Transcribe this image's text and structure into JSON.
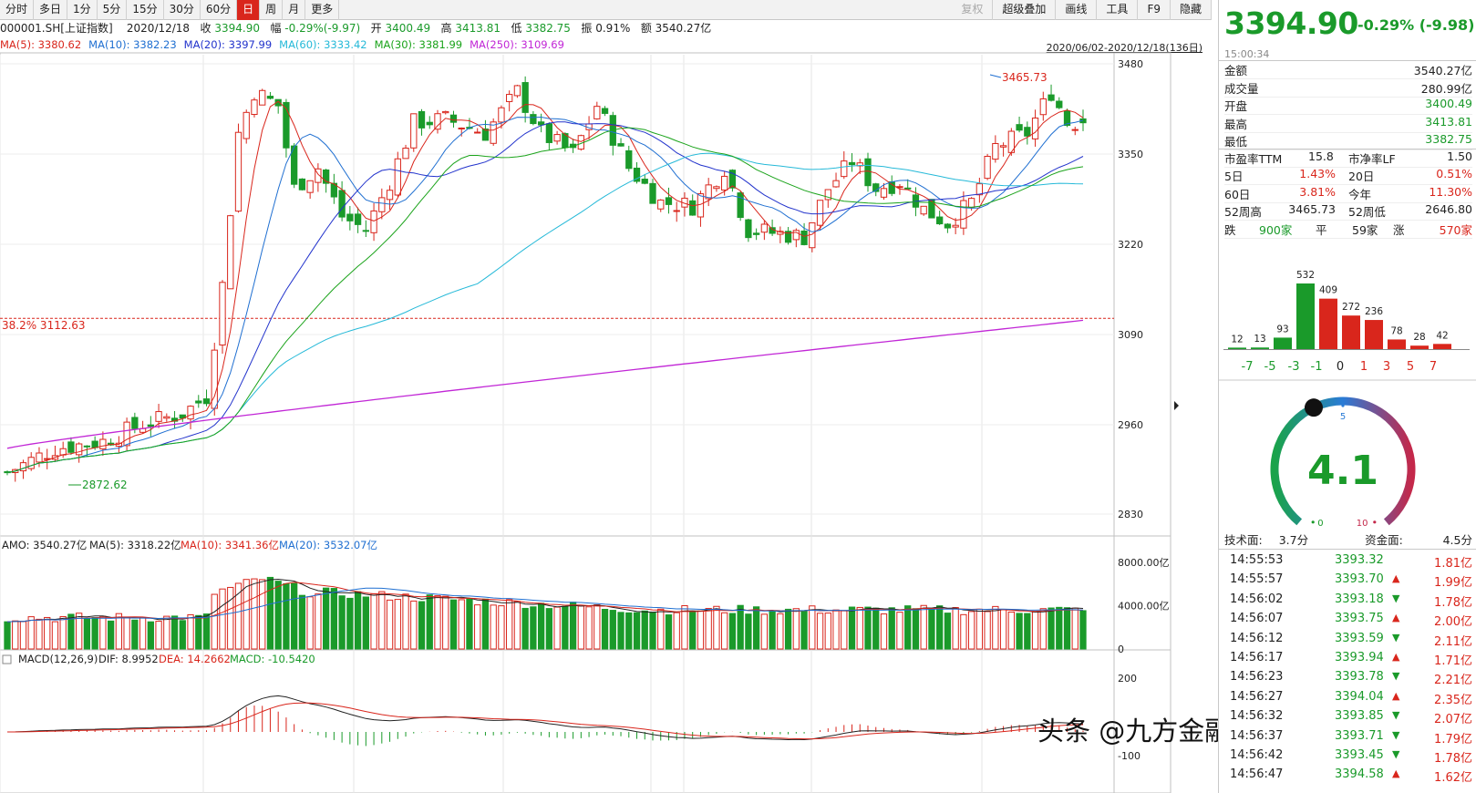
{
  "toolbar": {
    "periods": [
      "分时",
      "多日",
      "1分",
      "5分",
      "15分",
      "30分",
      "60分",
      "日",
      "周",
      "月",
      "更多"
    ],
    "active": "日",
    "right": [
      "复权",
      "超级叠加",
      "画线",
      "工具",
      "F9",
      "隐藏"
    ]
  },
  "info": {
    "code": "000001.SH[上证指数]",
    "date": "2020/12/18",
    "close_label": "收",
    "close": "3394.90",
    "amp_label": "幅",
    "change": "-0.29%(-9.97)",
    "open_label": "开",
    "open": "3400.49",
    "high_label": "高",
    "high": "3413.81",
    "low_label": "低",
    "low": "3382.75",
    "swing_label": "振",
    "swing": "0.91%",
    "amount_label": "额",
    "amount": "3540.27亿"
  },
  "ma": [
    {
      "label": "MA(5): 3380.62",
      "color": "#d9261c"
    },
    {
      "label": "MA(10): 3382.23",
      "color": "#1f6fd1"
    },
    {
      "label": "MA(20): 3397.99",
      "color": "#2233cc"
    },
    {
      "label": "MA(60): 3333.42",
      "color": "#25b9d8"
    },
    {
      "label": "MA(30): 3381.99",
      "color": "#1aa31a"
    },
    {
      "label": "MA(250): 3109.69",
      "color": "#c126d6"
    }
  ],
  "range": "2020/06/02-2020/12/18(136日)",
  "main_chart": {
    "y_ticks": [
      "3480",
      "3350",
      "3220",
      "3090",
      "2960",
      "2830"
    ],
    "fib_label": "38.2%  3112.63",
    "high_annot": "3465.73",
    "low_annot": "2872.62",
    "colors": {
      "up": "#d9261c",
      "down": "#1a9a2a"
    }
  },
  "vol": {
    "label_amo": "AMO: 3540.27亿",
    "label_ma5": "MA(5): 3318.22亿",
    "label_ma10": "MA(10): 3341.36亿",
    "label_ma20": "MA(20): 3532.07亿",
    "y_ticks": [
      "8000.00亿",
      "4000.00亿",
      "0"
    ]
  },
  "macd": {
    "label": "MACD(12,26,9)",
    "dif": "DIF: 8.9952",
    "dea": "DEA: 14.2662",
    "macd": "MACD: -10.5420",
    "y_ticks": [
      "200",
      "-100"
    ]
  },
  "watermark": "头条 @九方金融研究所",
  "quote": {
    "price": "3394.90",
    "change": "-0.29%  (-9.98)",
    "time": "15:00:34",
    "rows": [
      {
        "k": "金额",
        "v": "3540.27亿",
        "c": ""
      },
      {
        "k": "成交量",
        "v": "280.99亿",
        "c": ""
      },
      {
        "k": "开盘",
        "v": "3400.49",
        "c": "g"
      },
      {
        "k": "最高",
        "v": "3413.81",
        "c": "g"
      },
      {
        "k": "最低",
        "v": "3382.75",
        "c": "g"
      }
    ],
    "pe": {
      "k1": "市盈率TTM",
      "v1": "15.8",
      "k2": "市净率LF",
      "v2": "1.50"
    },
    "perf": [
      {
        "k1": "5日",
        "v1": "1.43%",
        "k2": "20日",
        "v2": "0.51%"
      },
      {
        "k1": "60日",
        "v1": "3.81%",
        "k2": "今年",
        "v2": "11.30%"
      },
      {
        "k1": "52周高",
        "v1": "3465.73",
        "k2": "52周低",
        "v2": "2646.80"
      }
    ],
    "breadth": {
      "fall_label": "跌",
      "fall": "900家",
      "flat_label": "平",
      "flat": "59家",
      "rise_label": "涨",
      "rise": "570家"
    }
  },
  "dist": {
    "labels": [
      "-7",
      "-5",
      "-3",
      "-1",
      "0",
      "1",
      "3",
      "5",
      "7"
    ],
    "values": [
      12,
      13,
      93,
      532,
      409,
      272,
      236,
      78,
      28,
      42
    ]
  },
  "gauge": {
    "value": "4.1",
    "min": "0",
    "mid": "5",
    "max": "10",
    "tech_label": "技术面:",
    "tech": "3.7分",
    "fund_label": "资金面:",
    "fund": "4.5分"
  },
  "ticks": [
    {
      "t": "14:55:53",
      "p": "3393.32",
      "a": "1.81亿",
      "d": ""
    },
    {
      "t": "14:55:57",
      "p": "3393.70",
      "a": "1.99亿",
      "d": "up"
    },
    {
      "t": "14:56:02",
      "p": "3393.18",
      "a": "1.78亿",
      "d": "down"
    },
    {
      "t": "14:56:07",
      "p": "3393.75",
      "a": "2.00亿",
      "d": "up"
    },
    {
      "t": "14:56:12",
      "p": "3393.59",
      "a": "2.11亿",
      "d": "down"
    },
    {
      "t": "14:56:17",
      "p": "3393.94",
      "a": "1.71亿",
      "d": "up"
    },
    {
      "t": "14:56:23",
      "p": "3393.78",
      "a": "2.21亿",
      "d": "down"
    },
    {
      "t": "14:56:27",
      "p": "3394.04",
      "a": "2.35亿",
      "d": "up"
    },
    {
      "t": "14:56:32",
      "p": "3393.85",
      "a": "2.07亿",
      "d": "down"
    },
    {
      "t": "14:56:37",
      "p": "3393.71",
      "a": "1.79亿",
      "d": "down"
    },
    {
      "t": "14:56:42",
      "p": "3393.45",
      "a": "1.78亿",
      "d": "down"
    },
    {
      "t": "14:56:47",
      "p": "3394.58",
      "a": "1.62亿",
      "d": "up"
    }
  ]
}
